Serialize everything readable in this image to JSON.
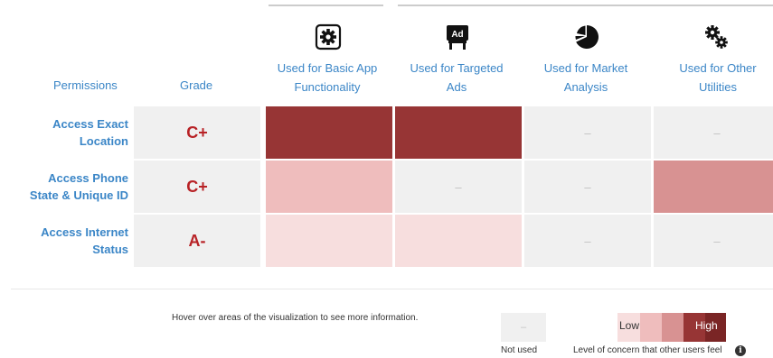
{
  "header": {
    "permissions_label": "Permissions",
    "grade_label": "Grade",
    "columns": [
      {
        "line1": "Used for Basic App",
        "line2": "Functionality",
        "icon": "gear-box-icon"
      },
      {
        "line1": "Used for Targeted",
        "line2": "Ads",
        "icon": "ad-sign-icon"
      },
      {
        "line1": "Used for Market",
        "line2": "Analysis",
        "icon": "pie-chart-icon"
      },
      {
        "line1": "Used for Other",
        "line2": "Utilities",
        "icon": "gears-icon"
      }
    ]
  },
  "rows": [
    {
      "line1": "Access Exact",
      "line2": "Location",
      "grade": "C+",
      "cells": [
        {
          "text": "",
          "level": 4
        },
        {
          "text": "",
          "level": 4
        },
        {
          "text": "–",
          "level": 0
        },
        {
          "text": "–",
          "level": 0
        }
      ]
    },
    {
      "line1": "Access Phone",
      "line2": "State & Unique ID",
      "grade": "C+",
      "cells": [
        {
          "text": "",
          "level": 2
        },
        {
          "text": "–",
          "level": 0
        },
        {
          "text": "–",
          "level": 0
        },
        {
          "text": "",
          "level": 3
        }
      ]
    },
    {
      "line1": "Access Internet",
      "line2": "Status",
      "grade": "A-",
      "cells": [
        {
          "text": "",
          "level": 1
        },
        {
          "text": "",
          "level": 1
        },
        {
          "text": "–",
          "level": 0
        },
        {
          "text": "–",
          "level": 0
        }
      ]
    }
  ],
  "colors": {
    "empty": "#f0f0f0",
    "levels": [
      "#f0f0f0",
      "#f7dede",
      "#efbdbd",
      "#d89292",
      "#973535"
    ],
    "scale": [
      "#f7dede",
      "#efbdbd",
      "#d89292",
      "#973535",
      "#7a2525"
    ],
    "grade": "#b82226",
    "link": "#3b86c7"
  },
  "legend": {
    "hover_note": "Hover over areas of the visualization to see more information.",
    "not_used_symbol": "–",
    "not_used_label": "Not used",
    "low_label": "Low",
    "high_label": "High",
    "concern_label": "Level of concern that other users feel",
    "info_icon": "info-icon",
    "info_glyph": "i"
  }
}
